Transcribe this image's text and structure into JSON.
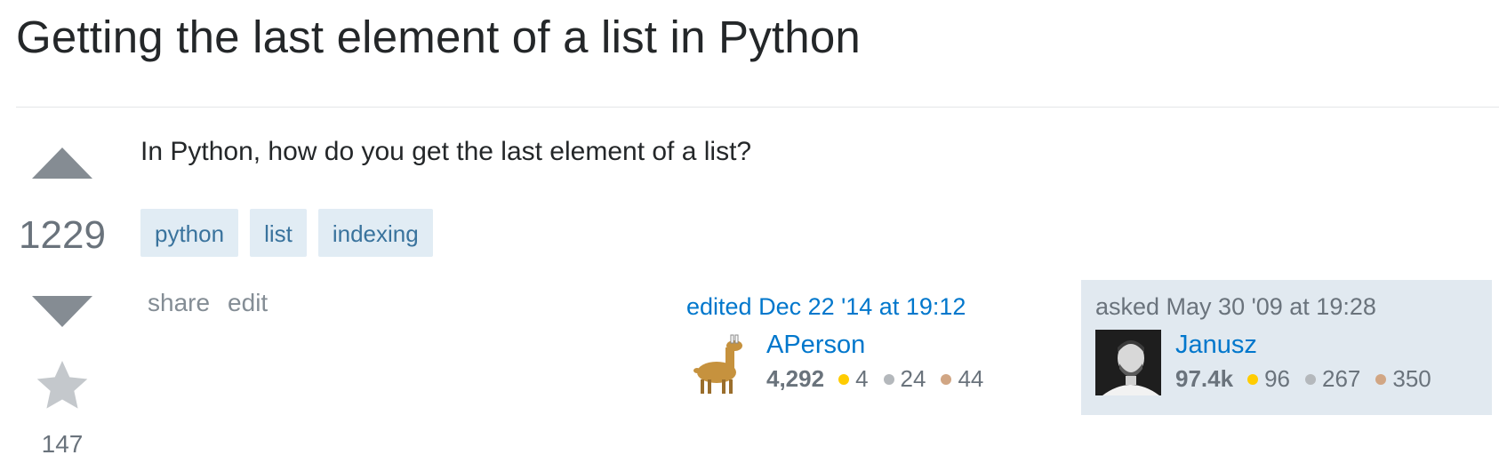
{
  "question": {
    "title": "Getting the last element of a list in Python",
    "body": "In Python, how do you get the last element of a list?",
    "score": "1229",
    "favorite_count": "147",
    "tags": [
      "python",
      "list",
      "indexing"
    ]
  },
  "post_menu": {
    "share": "share",
    "edit": "edit"
  },
  "editor": {
    "action": "edited Dec 22 '14 at 19:12",
    "name": "APerson",
    "reputation": "4,292",
    "gold": "4",
    "silver": "24",
    "bronze": "44"
  },
  "owner": {
    "action": "asked May 30 '09 at 19:28",
    "name": "Janusz",
    "reputation": "97.4k",
    "gold": "96",
    "silver": "267",
    "bronze": "350"
  },
  "colors": {
    "gold": "#ffcc01",
    "silver": "#b4b8bc",
    "bronze": "#d1a684",
    "link": "#0077cc",
    "tag_bg": "#e1ecf4",
    "tag_text": "#39739d",
    "owner_card_bg": "#e1e9f0"
  }
}
